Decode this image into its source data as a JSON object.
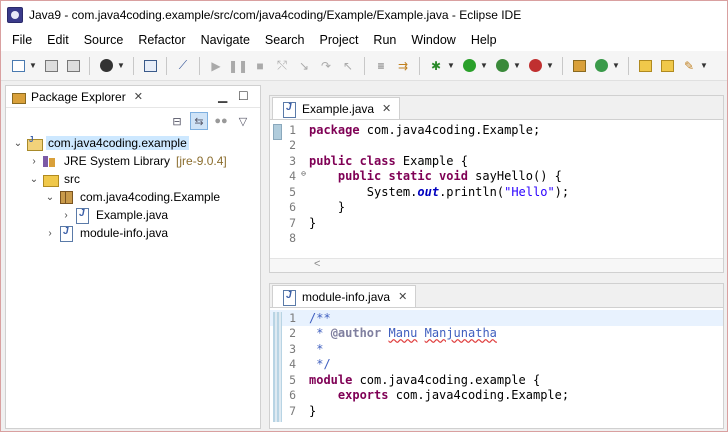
{
  "window": {
    "title": "Java9 - com.java4coding.example/src/com/java4coding/Example/Example.java - Eclipse IDE"
  },
  "menu": [
    "File",
    "Edit",
    "Source",
    "Refactor",
    "Navigate",
    "Search",
    "Project",
    "Run",
    "Window",
    "Help"
  ],
  "explorer": {
    "tab_label": "Package Explorer",
    "tree": [
      {
        "label": "com.java4coding.example",
        "decoration": ""
      },
      {
        "label": "JRE System Library",
        "decoration": "[jre-9.0.4]"
      },
      {
        "label": "src",
        "decoration": ""
      },
      {
        "label": "com.java4coding.Example",
        "decoration": ""
      },
      {
        "label": "Example.java",
        "decoration": ""
      },
      {
        "label": "module-info.java",
        "decoration": ""
      }
    ]
  },
  "editor1": {
    "tab_label": "Example.java",
    "line_numbers": [
      "1",
      "2",
      "3",
      "4",
      "5",
      "6",
      "7",
      "8"
    ],
    "lines": [
      {
        "kw": "package",
        "rest": " com.java4coding.Example;"
      },
      {
        "kw": "",
        "rest": ""
      },
      {
        "kw": "public class",
        "rest": " Example {"
      },
      {
        "kw": "public static void",
        "rest": " sayHello() {"
      },
      {
        "pre": "System.",
        "it": "out",
        "mid": ".println(",
        "str": "\"Hello\"",
        "end": ");"
      },
      {
        "rest": "}"
      },
      {
        "rest": "}"
      },
      {
        "rest": ""
      }
    ]
  },
  "editor2": {
    "tab_label": "module-info.java",
    "line_numbers": [
      "1",
      "2",
      "3",
      "4",
      "5",
      "6",
      "7"
    ],
    "lines": [
      {
        "cm": "/**"
      },
      {
        "cm": " * ",
        "ann": "@author",
        "cm2": " ",
        "spell1": "Manu",
        "cm3": " ",
        "spell2": "Manjunatha"
      },
      {
        "cm": " *"
      },
      {
        "cm": " */"
      },
      {
        "kw": "module",
        "rest": " com.java4coding.example {"
      },
      {
        "kw": "exports",
        "rest": " com.java4coding.Example;"
      },
      {
        "rest": "}"
      }
    ]
  }
}
